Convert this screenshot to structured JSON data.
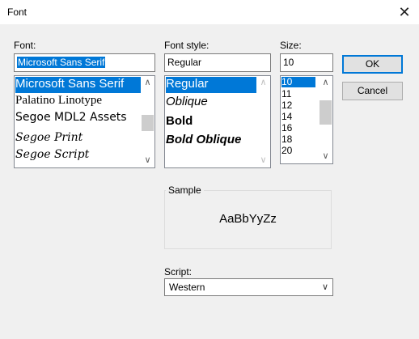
{
  "window": {
    "title": "Font",
    "close_glyph": "✕"
  },
  "font": {
    "label": "Font:",
    "value": "Microsoft Sans Serif",
    "items": [
      {
        "label": "Microsoft Sans Serif",
        "selected": true
      },
      {
        "label": "Palatino Linotype",
        "selected": false
      },
      {
        "label": "Segoe MDL2 Assets",
        "selected": false
      },
      {
        "label": "Segoe Print",
        "selected": false
      },
      {
        "label": "Segoe Script",
        "selected": false
      }
    ]
  },
  "style": {
    "label": "Font style:",
    "value": "Regular",
    "items": [
      {
        "label": "Regular",
        "selected": true
      },
      {
        "label": "Oblique",
        "selected": false
      },
      {
        "label": "Bold",
        "selected": false
      },
      {
        "label": "Bold Oblique",
        "selected": false
      }
    ]
  },
  "size": {
    "label": "Size:",
    "value": "10",
    "items": [
      "10",
      "11",
      "12",
      "14",
      "16",
      "18",
      "20"
    ],
    "selected": "10"
  },
  "buttons": {
    "ok": "OK",
    "cancel": "Cancel"
  },
  "sample": {
    "label": "Sample",
    "text": "AaBbYyZz"
  },
  "script": {
    "label": "Script:",
    "value": "Western"
  },
  "icons": {
    "scroll_up": "∧",
    "scroll_down": "∨",
    "dropdown": "∨"
  }
}
